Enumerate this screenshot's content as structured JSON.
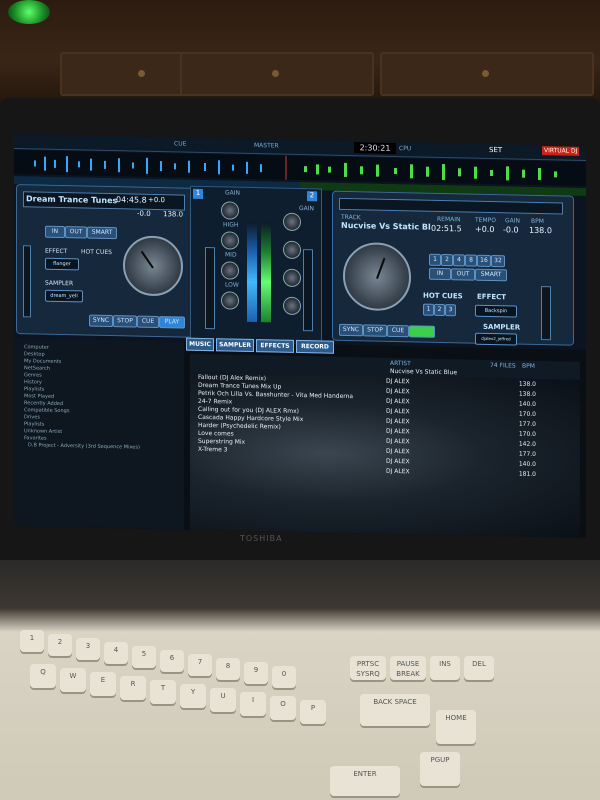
{
  "ui": {
    "topbar": {
      "master_label": "MASTER",
      "cue_label": "CUE",
      "clock": "2:30:21",
      "cpu_label": "CPU",
      "set_label": "SET",
      "brand": "VIRTUAL DJ"
    },
    "deck_left": {
      "number": "1",
      "track": "Dream Trance Tunes",
      "remain": "04:45.8",
      "pitch": "+0.0",
      "gain": "-0.0",
      "bpm": "138.0",
      "buttons": {
        "in": "IN",
        "out": "OUT",
        "smart": "SMART",
        "sync": "SYNC",
        "stop": "STOP",
        "cue": "CUE",
        "play": "PLAY"
      },
      "effect_label": "EFFECT",
      "effect_value": "flanger",
      "hotcues_label": "HOT CUES",
      "sampler_label": "SAMPLER",
      "sampler_value": "dream_yell"
    },
    "deck_right": {
      "number": "2",
      "track_label": "TRACK",
      "track": "Nucvise Vs Static Bl",
      "remain_label": "REMAIN",
      "tempo_label": "TEMPO",
      "gain_label": "GAIN",
      "bpm_label": "BPM",
      "remain": "02:51.5",
      "tempo": "+0.0",
      "gain": "-0.0",
      "bpm": "138.0",
      "loop_values": [
        "1",
        "2",
        "4",
        "8",
        "16",
        "32"
      ],
      "buttons": {
        "in": "IN",
        "out": "OUT",
        "smart": "SMART",
        "sync": "SYNC",
        "stop": "STOP",
        "cue": "CUE",
        "play": "PLAY"
      },
      "hotcues_label": "HOT CUES",
      "hotcues": [
        "1",
        "2",
        "3"
      ],
      "effect_label": "EFFECT",
      "effect_value": "Backspin",
      "sampler_label": "SAMPLER",
      "sampler_value": "djalex2_jeffred"
    },
    "mixer": {
      "gain": "GAIN",
      "high": "HIGH",
      "mid": "MID",
      "low": "LOW"
    },
    "tabs": [
      "MUSIC",
      "SAMPLER",
      "EFFECTS",
      "RECORD"
    ],
    "browser": {
      "tree": [
        "Computer",
        "Desktop",
        "My Documents",
        "NetSearch",
        "Genres",
        "History",
        "Playlists",
        "Most Played",
        "Recently Added",
        "Compatible Songs",
        "Drives",
        "Playlists",
        "Unknown Artist",
        "Favorites"
      ],
      "header": {
        "artist": "ARTIST",
        "bpm": "BPM",
        "files": "74 FILES"
      },
      "search_artist": "Nucvise Vs Static Blue",
      "tracks": [
        {
          "title": "Fallout (DJ Alex Remix)",
          "artist": "DJ ALEX",
          "bpm": "138.0"
        },
        {
          "title": "Dream Trance Tunes Mix Up",
          "artist": "DJ ALEX",
          "bpm": "138.0"
        },
        {
          "title": "Petrik Och Lilla Vs. Basshunter - Vita Med Handerna",
          "artist": "DJ ALEX",
          "bpm": "140.0"
        },
        {
          "title": "24-7 Remix",
          "artist": "DJ ALEX",
          "bpm": "170.0"
        },
        {
          "title": "Calling out for you (DJ ALEX Rmx)",
          "artist": "DJ ALEX",
          "bpm": "177.0"
        },
        {
          "title": "Cascada Happy Hardcore Style Mix",
          "artist": "DJ ALEX",
          "bpm": "170.0"
        },
        {
          "title": "Harder (Psychedelic Remix)",
          "artist": "DJ ALEX",
          "bpm": "142.0"
        },
        {
          "title": "Love comes",
          "artist": "DJ ALEX",
          "bpm": "177.0"
        },
        {
          "title": "Superstring Mix",
          "artist": "DJ ALEX",
          "bpm": "140.0"
        },
        {
          "title": "X-Treme 3",
          "artist": "DJ ALEX",
          "bpm": "181.0"
        }
      ],
      "footer_track": "D.B Project - Adversity (3rd Sequence Mixes)"
    }
  },
  "laptop": {
    "brand": "TOSHIBA"
  },
  "keys": {
    "fn_row": [
      "PRTSC SYSRQ",
      "PAUSE BREAK",
      "INS",
      "DEL"
    ],
    "nav": [
      "BACK SPACE",
      "HOME",
      "ENTER",
      "PGUP"
    ],
    "letters_top": [
      "1",
      "2",
      "3",
      "4",
      "5",
      "6",
      "7",
      "8",
      "9",
      "0"
    ],
    "letters_q": [
      "Q",
      "W",
      "E",
      "R",
      "T",
      "Y",
      "U",
      "I",
      "O",
      "P"
    ]
  }
}
